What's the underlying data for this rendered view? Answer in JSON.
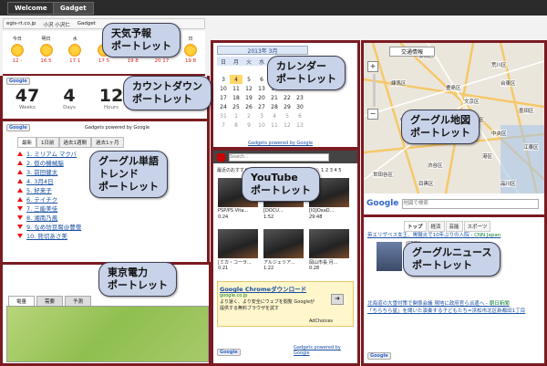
{
  "tabs": {
    "welcome": "Welcome",
    "gadget": "Gadget"
  },
  "address": {
    "domain": "egis-rt.co.jp",
    "crumb1": "小沢 小沢仁",
    "crumb2": "Gadget"
  },
  "weather": {
    "days": [
      "今日",
      "明日",
      "水",
      "木",
      "金",
      "土",
      "日"
    ],
    "temps": [
      "12|-",
      "16|5",
      "17|1",
      "17|5",
      "19|8",
      "20|17",
      "19|8"
    ]
  },
  "countdown": {
    "values": [
      "47",
      "4",
      "12",
      "0"
    ],
    "units": [
      "Weeks",
      "Days",
      "Hours",
      "Minutes"
    ],
    "google_label": "Google"
  },
  "calendar": {
    "title": "2013年 3月",
    "weekdays": [
      "日",
      "月",
      "火",
      "水",
      "木",
      "金",
      "土"
    ],
    "weeks": [
      [
        "",
        "",
        "",
        "",
        "",
        "1",
        "2"
      ],
      [
        "3",
        "4",
        "5",
        "6",
        "7",
        "8",
        "9"
      ],
      [
        "10",
        "11",
        "12",
        "13",
        "14",
        "15",
        "16"
      ],
      [
        "17",
        "18",
        "19",
        "20",
        "21",
        "22",
        "23"
      ],
      [
        "24",
        "25",
        "26",
        "27",
        "28",
        "29",
        "30"
      ],
      [
        "31",
        "1",
        "2",
        "3",
        "4",
        "5",
        "6"
      ],
      [
        "7",
        "8",
        "9",
        "10",
        "11",
        "12",
        "13"
      ]
    ],
    "footer": "Gadgets powered by Google"
  },
  "trends": {
    "tabs": [
      "最新",
      "1日前",
      "過去1週間",
      "過去1ヶ月"
    ],
    "items": [
      "ミリアム マクバ",
      "仮の機械脳",
      "前田健太",
      "3月4日",
      "好来子",
      "テイチク",
      "三能美佳",
      "湘南乃風",
      "なめ坊豆腐@豊僧",
      "熊切あさ美"
    ],
    "dirs": [
      "up",
      "up",
      "up",
      "up",
      "up",
      "up",
      "dn",
      "dn",
      "dn",
      "dn"
    ],
    "footer": "Gadgets powered by Google"
  },
  "map": {
    "traffic_btn": "交通情報",
    "search_placeholder": "地図で検索",
    "labels": [
      "板橋区",
      "練馬区",
      "豊島区",
      "台東区",
      "墨田区",
      "中野区",
      "新宿区",
      "渋谷区",
      "港区",
      "目黒区",
      "品川区",
      "世田谷区",
      "中央区",
      "江東区",
      "千代田区",
      "文京区",
      "荒川区"
    ]
  },
  "youtube": {
    "search_placeholder": "Search...",
    "section": "最近のおすすめ",
    "page": "ページ: 1 2 3 4 5",
    "row1": [
      {
        "title": "PSP/PS Vita...",
        "time": "0:24"
      },
      {
        "title": "[DOCU...",
        "time": "1:52"
      },
      {
        "title": "[IOJOxaD...",
        "time": "29:48"
      }
    ],
    "row2": [
      {
        "title": "[ミカ・コーラ...",
        "time": "0:21"
      },
      {
        "title": "アルジェリア...",
        "time": "1:22"
      },
      {
        "title": "岡山市長 月...",
        "time": "0:28"
      }
    ],
    "ad_title": "Google Chromeダウンロード",
    "ad_url": "google.co.jp",
    "ad_text": "より速く、より安全にウェブを閲覧 Googleが提供する無料ブラウザを試す",
    "ad_choices": "AdChoices",
    "footer": "Gadgets powered by Google"
  },
  "news": {
    "tabs": [
      "トップ",
      "経済",
      "芸能",
      "スポーツ"
    ],
    "items": [
      "英エリザベス女王、胃腸炎で10年ぶりの入院",
      "(CNN)",
      "英女王",
      "北海道の大雪対策で関係会議 現地に政府官ら派遣へ",
      "「ちらちら星」を聞いた演奏する子どもたち=浜松市北区新都田1丁目"
    ],
    "sources": [
      "CNN Japan",
      "朝日新聞"
    ],
    "footer": "Google"
  },
  "tepco": {
    "tabs": [
      "電量",
      "需要",
      "予測"
    ]
  },
  "callouts": {
    "weather": "天気予報\nポートレット",
    "countdown": "カウントダウン\nポートレット",
    "calendar": "カレンダー\nポートレット",
    "map": "グーグル地図\nポートレット",
    "trends": "グーグル単語\nトレンド\nポートレット",
    "youtube": "YouTube\nポートレット",
    "news": "グーグルニュース\nポートレット",
    "tepco": "東京電力\nポートレット"
  },
  "colors": {
    "frame": "#7a1b22",
    "callout_bg": "#c8d2e8"
  }
}
